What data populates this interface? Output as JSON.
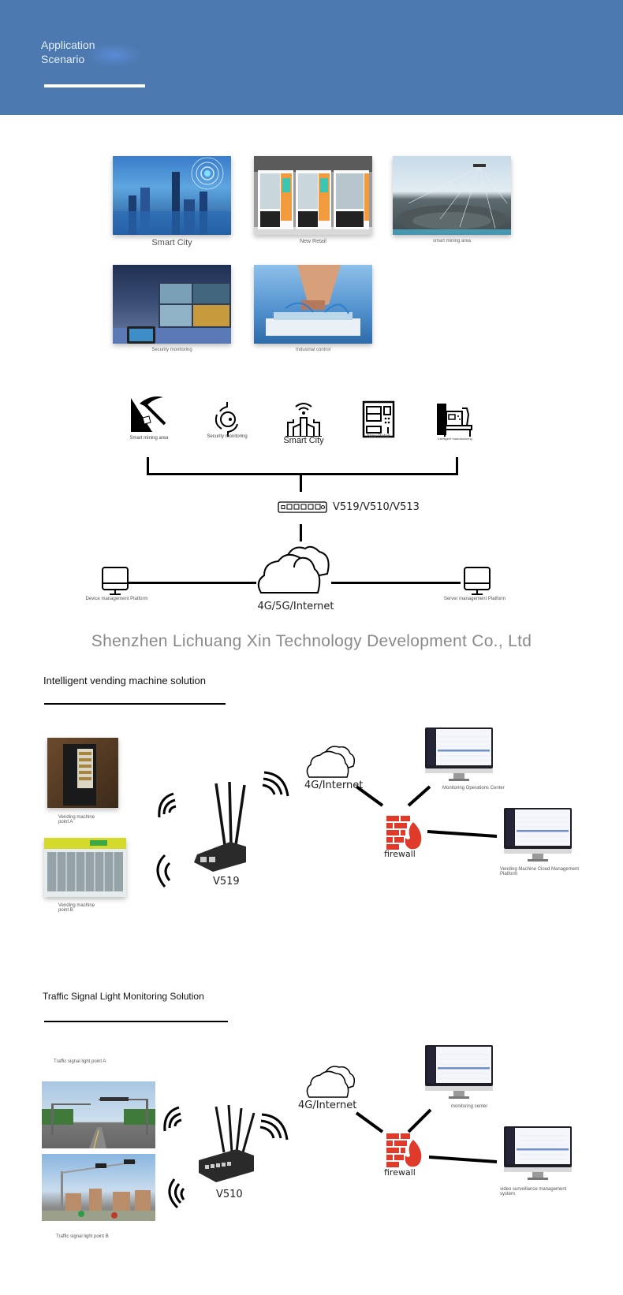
{
  "header": {
    "title_line1": "Application",
    "title_line2": "Scenario",
    "background_color": "#4c7ab0"
  },
  "scenarios": [
    {
      "label": "Smart City",
      "image": "smart-city-photo"
    },
    {
      "label": "New Retail",
      "image": "vending-machines-photo"
    },
    {
      "label": "smart mining area",
      "image": "mining-area-photo"
    },
    {
      "label": "Security monitoring",
      "image": "monitoring-room-photo"
    },
    {
      "label": "Industrial control",
      "image": "industrial-robot-photo"
    }
  ],
  "topology": {
    "icons": [
      {
        "label": "Smart mining area",
        "icon": "pickaxe-mine-icon"
      },
      {
        "label": "Security monitoring",
        "icon": "camera-icon"
      },
      {
        "label": "Smart City",
        "icon": "smart-city-icon"
      },
      {
        "label": "New Retail",
        "icon": "vending-machine-icon"
      },
      {
        "label": "Intelligent manufacturing",
        "icon": "industrial-machine-icon"
      }
    ],
    "router_label": "V519/V510/V513",
    "cloud_label": "4G/5G/Internet",
    "left_platform": "Device management Platform",
    "right_platform": "Server management Platform"
  },
  "company_name": "Shenzhen Lichuang Xin Technology Development Co., Ltd",
  "vending_solution": {
    "title": "Intelligent vending machine solution",
    "point_a": "Vending machine point A",
    "point_b": "Vending machine point B",
    "router_label": "V519",
    "cloud_label": "4G/Internet",
    "firewall_label": "firewall",
    "monitor_1": "Monitoring Operations Center",
    "monitor_2": "Vending Machine Cloud Management Platform"
  },
  "traffic_solution": {
    "title": "Traffic Signal Light Monitoring Solution",
    "point_a": "Traffic signal light point A",
    "point_b": "Traffic signal light point B",
    "router_label": "V510",
    "cloud_label": "4G/Internet",
    "firewall_label": "firewall",
    "monitor_1": "monitoring center",
    "monitor_2": "video surveillance management system"
  },
  "colors": {
    "firewall": "#e03a2a",
    "company_text": "#8a8a8a"
  }
}
